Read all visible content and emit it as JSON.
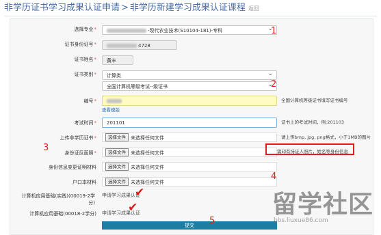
{
  "header": {
    "crumb1": "非学历证书学习成果认证申请",
    "separator": ">",
    "crumb2": "非学历新建学习成果认证课程",
    "back": "返回"
  },
  "form": {
    "major": {
      "label": "选择专业",
      "value": "-现代农业技术(S10104-181)-专科"
    },
    "id_number": {
      "label": "证书身份证号",
      "value": "4728"
    },
    "cert_name": {
      "label": "证书姓名",
      "value": "黄丰"
    },
    "cert_type": {
      "label": "证书类别",
      "value": "计算类",
      "value2": "全国计算机等级考试--级证书"
    },
    "number": {
      "label": "编号",
      "hint": "全国计算机等级证书填写证书编号",
      "link": "查看模版"
    },
    "exam_date": {
      "label": "考试时间",
      "value": "201101",
      "hint": "证书上的考试时间，例:201103"
    },
    "upload_cert": {
      "label": "上传非学历证书",
      "button": "选择文件",
      "status": "未选择任何文件",
      "hint": "请上传bmp, jpg, png格式，小于1MB的图片"
    },
    "id_back": {
      "label": "身份证反面照",
      "button": "选择文件",
      "status": "未选择任何文件",
      "hint": "需印有持证人照片，姓名等身份信息"
    },
    "id_change": {
      "label": "身份信息变更证明材料",
      "button": "选择文件",
      "status": "未选择任何文件"
    },
    "household": {
      "label": "户口本材料",
      "button": "选择文件",
      "status": "未选择任何文件"
    },
    "course1": {
      "label": "计算机应用基础(实践)(00019-2学分)",
      "value": "申请学习成果认证"
    },
    "course2": {
      "label": "计算机应用基础(00018-2学分)",
      "value": "申请学习成果认证"
    },
    "submit": "提交"
  },
  "annotations": {
    "n1": "1",
    "n2": "2",
    "n3": "3",
    "n4": "4",
    "n5": "5",
    "check_mark": "✔",
    "color": "#e02020"
  },
  "watermark": {
    "brand": "留学社区",
    "url": "bbs.liuxue86.com"
  }
}
